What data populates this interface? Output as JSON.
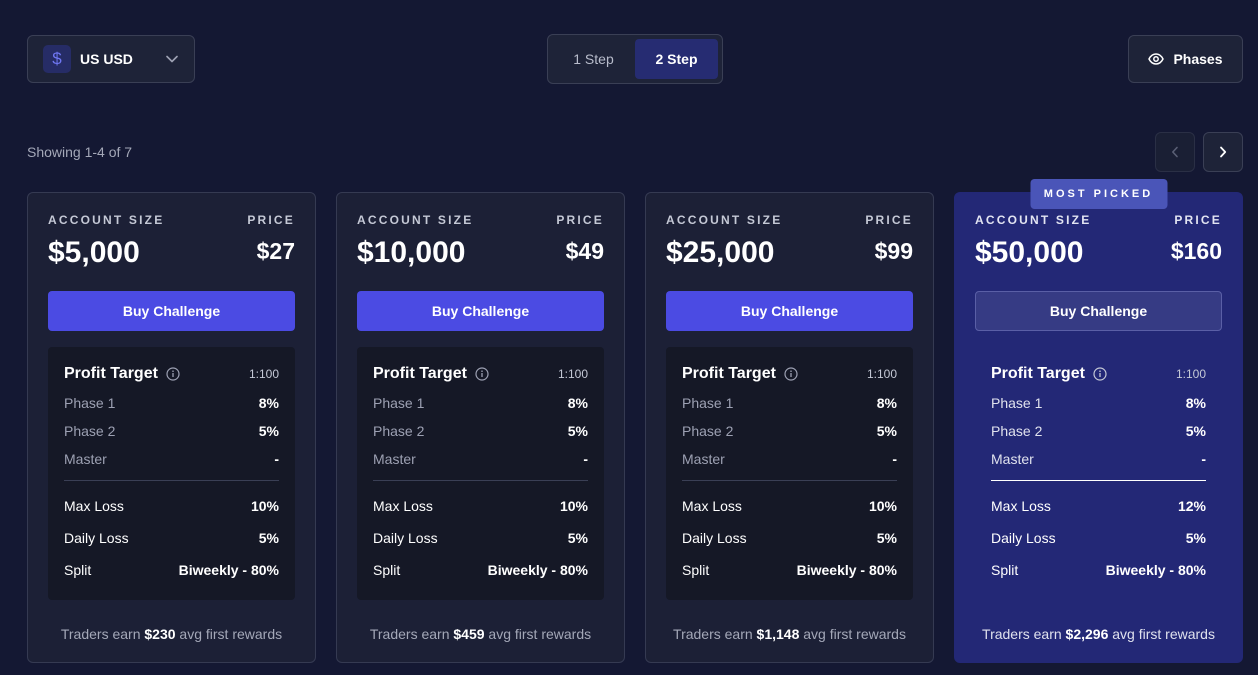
{
  "currency": {
    "symbol": "$",
    "label": "US USD"
  },
  "steps": [
    {
      "label": "1 Step",
      "active": false
    },
    {
      "label": "2 Step",
      "active": true
    }
  ],
  "phases_button": {
    "label": "Phases"
  },
  "showing_text": "Showing 1-4 of 7",
  "card_labels": {
    "account_size": "ACCOUNT SIZE",
    "price": "PRICE",
    "buy": "Buy Challenge",
    "profit_target": "Profit Target",
    "leverage": "1:100",
    "phase1": "Phase 1",
    "phase2": "Phase 2",
    "master": "Master",
    "max_loss": "Max Loss",
    "daily_loss": "Daily Loss",
    "split": "Split",
    "earn_prefix": "Traders earn",
    "earn_suffix": "avg first rewards",
    "most_picked": "MOST PICKED"
  },
  "cards": [
    {
      "account_size": "$5,000",
      "price": "$27",
      "phase1": "8%",
      "phase2": "5%",
      "master": "-",
      "max_loss": "10%",
      "daily_loss": "5%",
      "split": "Biweekly - 80%",
      "earn": "$230"
    },
    {
      "account_size": "$10,000",
      "price": "$49",
      "phase1": "8%",
      "phase2": "5%",
      "master": "-",
      "max_loss": "10%",
      "daily_loss": "5%",
      "split": "Biweekly - 80%",
      "earn": "$459"
    },
    {
      "account_size": "$25,000",
      "price": "$99",
      "phase1": "8%",
      "phase2": "5%",
      "master": "-",
      "max_loss": "10%",
      "daily_loss": "5%",
      "split": "Biweekly - 80%",
      "earn": "$1,148"
    },
    {
      "account_size": "$50,000",
      "price": "$160",
      "phase1": "8%",
      "phase2": "5%",
      "master": "-",
      "max_loss": "12%",
      "daily_loss": "5%",
      "split": "Biweekly - 80%",
      "earn": "$2,296"
    }
  ],
  "colors": {
    "background": "#141833",
    "accent": "#4b4be3",
    "featured": "#232876"
  }
}
